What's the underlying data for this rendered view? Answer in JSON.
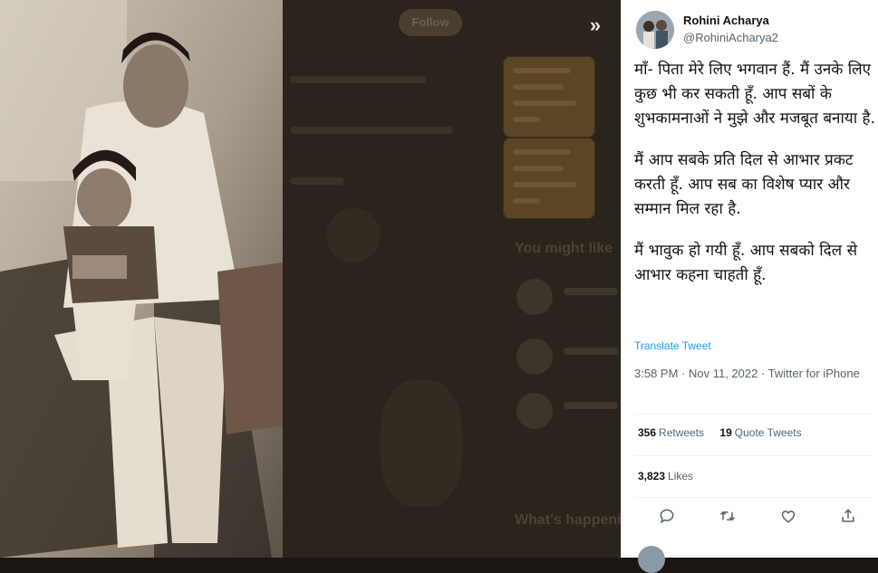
{
  "lightbox": {
    "next_icon": "chevron-double-right-icon",
    "next_glyph": "»"
  },
  "background_page": {
    "follow_label": "Follow",
    "you_might_like": "You might like",
    "whats_happening": "What's happening"
  },
  "tweet": {
    "author": {
      "display_name": "Rohini Acharya",
      "handle": "@RohiniAcharya2"
    },
    "text": {
      "p1": "माँ- पिता मेरे लिए भगवान हैं. मैं उनके लिए कुछ भी कर सकती हूँ. आप सबों के शुभकामनाओं ने मुझे और मजबूत बनाया है.",
      "p2": "मैं आप सबके प्रति दिल से आभार प्रकट करती हूँ. आप सब का विशेष प्यार और सम्मान मिल रहा है.",
      "p3": "मैं भावुक हो गयी हूँ. आप सबको दिल से आभार कहना चाहती हूँ."
    },
    "translate_label": "Translate Tweet",
    "timestamp": "3:58 PM · Nov 11, 2022 · Twitter for iPhone",
    "stats": {
      "retweets_count": "356",
      "retweets_label": "Retweets",
      "quotes_count": "19",
      "quotes_label": "Quote Tweets",
      "likes_count": "3,823",
      "likes_label": "Likes"
    },
    "actions": [
      "reply-icon",
      "retweet-icon",
      "like-icon",
      "share-icon"
    ]
  },
  "colors": {
    "link": "#1d9bf0",
    "text": "#0f1419",
    "muted": "#536471"
  }
}
